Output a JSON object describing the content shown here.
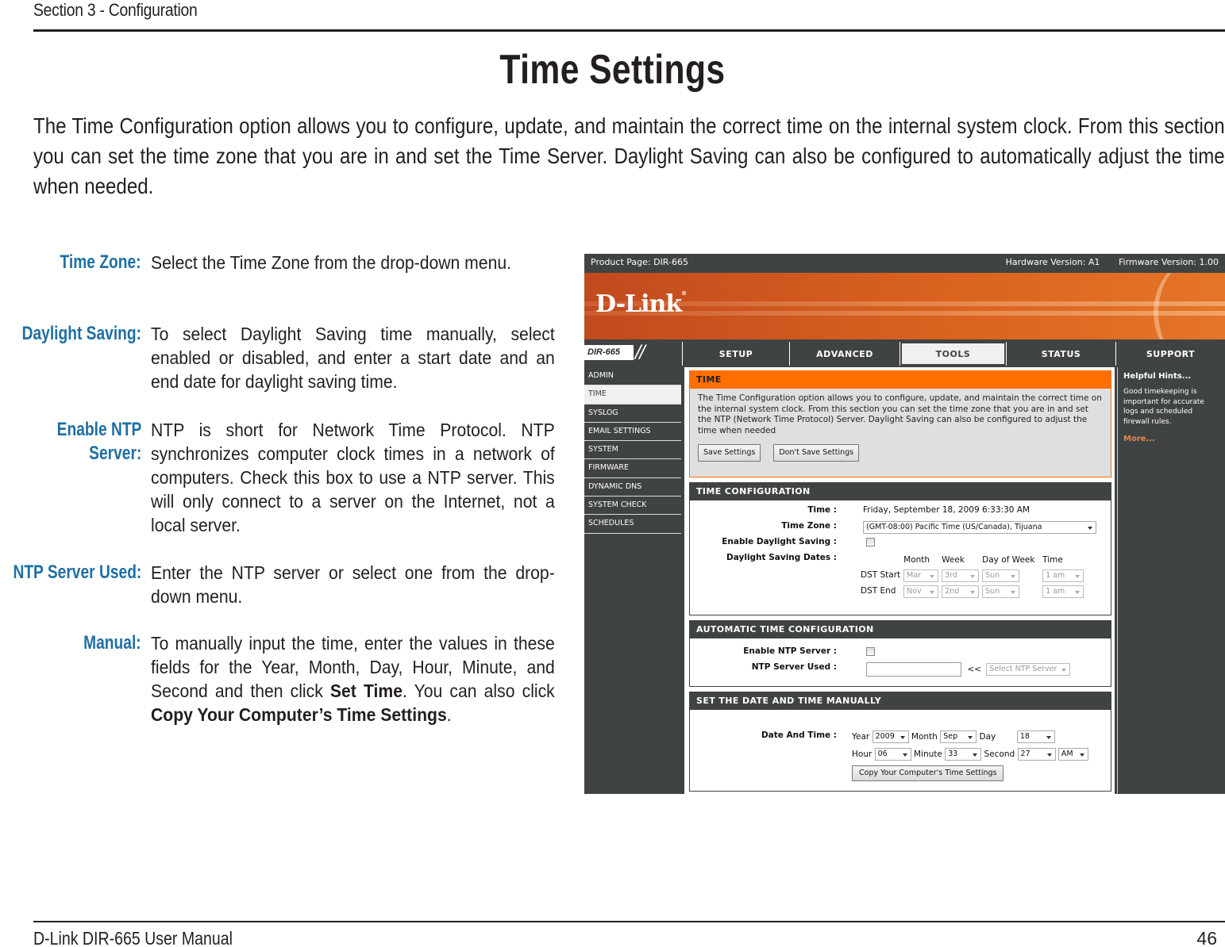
{
  "page": {
    "section_header": "Section 3 - Configuration",
    "title": "Time Settings",
    "intro": "The Time Configuration option allows you to configure, update, and maintain the correct time on the internal system clock. From this section you can set the time zone that you are in and set the Time Server. Daylight Saving can also be configured to automatically adjust the time when needed.",
    "descriptions": [
      {
        "label": "Time Zone:",
        "text": "Select the Time Zone from the drop-down menu."
      },
      {
        "label": "Daylight Saving:",
        "text": "To select Daylight Saving time manually, select enabled or disabled, and enter a start date and an end date for daylight saving time."
      },
      {
        "label_line1": "Enable NTP",
        "label_line2": "Server:",
        "text": "NTP is short for Network Time Protocol. NTP synchronizes computer clock times in a network of computers. Check this box to use a NTP server. This will only connect to a server on the Internet, not a local server."
      },
      {
        "label": "NTP Server Used:",
        "text": "Enter the NTP server or select one from the drop-down menu."
      },
      {
        "label": "Manual:",
        "text_1": "To manually input the time, enter the values in these fields for the Year, Month, Day, Hour, Minute, and Second and then click ",
        "bold_1": "Set Time",
        "text_2": ". You can also click ",
        "bold_2": "Copy Your Computer’s Time Settings",
        "text_3": "."
      }
    ],
    "footer_left": "D-Link DIR-665 User Manual",
    "page_number": "46"
  },
  "router": {
    "topbar": {
      "product": "Product Page: DIR-665",
      "hardware": "Hardware Version: A1",
      "firmware": "Firmware Version: 1.00"
    },
    "logo": "D-Link",
    "logo_mark": "®",
    "model_tag": "DIR-665",
    "model_slash": "//",
    "tabs": [
      {
        "label": "SETUP",
        "active": false
      },
      {
        "label": "ADVANCED",
        "active": false
      },
      {
        "label": "TOOLS",
        "active": true
      },
      {
        "label": "STATUS",
        "active": false
      },
      {
        "label": "SUPPORT",
        "active": false
      }
    ],
    "sidebar": [
      "ADMIN",
      "TIME",
      "SYSLOG",
      "EMAIL SETTINGS",
      "SYSTEM",
      "FIRMWARE",
      "DYNAMIC DNS",
      "SYSTEM CHECK",
      "SCHEDULES"
    ],
    "sidebar_active": "TIME",
    "time_box": {
      "header": "TIME",
      "text": "The Time Configuration option allows you to configure, update, and maintain the correct time on the internal system clock. From this section you can set the time zone that you are in and set the NTP (Network Time Protocol) Server. Daylight Saving can also be configured to adjust the time when needed",
      "save_label": "Save Settings",
      "dont_save_label": "Don't Save Settings"
    },
    "time_config": {
      "header": "TIME CONFIGURATION",
      "time_label": "Time :",
      "time_value": "Friday, September 18, 2009 6:33:30 AM",
      "zone_label": "Time Zone :",
      "zone_value": "(GMT-08:00) Pacific Time (US/Canada), Tijuana",
      "dst_enable_label": "Enable Daylight Saving :",
      "dst_enable_checked": false,
      "dst_dates_label": "Daylight Saving Dates :",
      "col_month": "Month",
      "col_week": "Week",
      "col_dow": "Day of Week",
      "col_time": "Time",
      "dst_start": {
        "label": "DST Start",
        "month": "Mar",
        "week": "3rd",
        "dow": "Sun",
        "time": "1 am"
      },
      "dst_end": {
        "label": "DST End",
        "month": "Nov",
        "week": "2nd",
        "dow": "Sun",
        "time": "1 am"
      }
    },
    "auto_config": {
      "header": "AUTOMATIC TIME CONFIGURATION",
      "ntp_enable_label": "Enable NTP Server :",
      "ntp_enable_checked": false,
      "ntp_used_label": "NTP Server Used :",
      "ntp_used_value": "",
      "arrow": "<<",
      "ntp_select": "Select NTP Server"
    },
    "manual": {
      "header": "SET THE DATE AND TIME MANUALLY",
      "label": "Date And Time :",
      "year_label": "Year",
      "year": "2009",
      "month_label": "Month",
      "month": "Sep",
      "day_label": "Day",
      "day": "18",
      "hour_label": "Hour",
      "hour": "06",
      "minute_label": "Minute",
      "minute": "33",
      "second_label": "Second",
      "second": "27",
      "ampm": "AM",
      "copy_label": "Copy Your Computer's Time Settings"
    },
    "hints": {
      "title": "Helpful Hints...",
      "body": "Good timekeeping is important for accurate logs and scheduled firewall rules.",
      "more": "More..."
    }
  }
}
